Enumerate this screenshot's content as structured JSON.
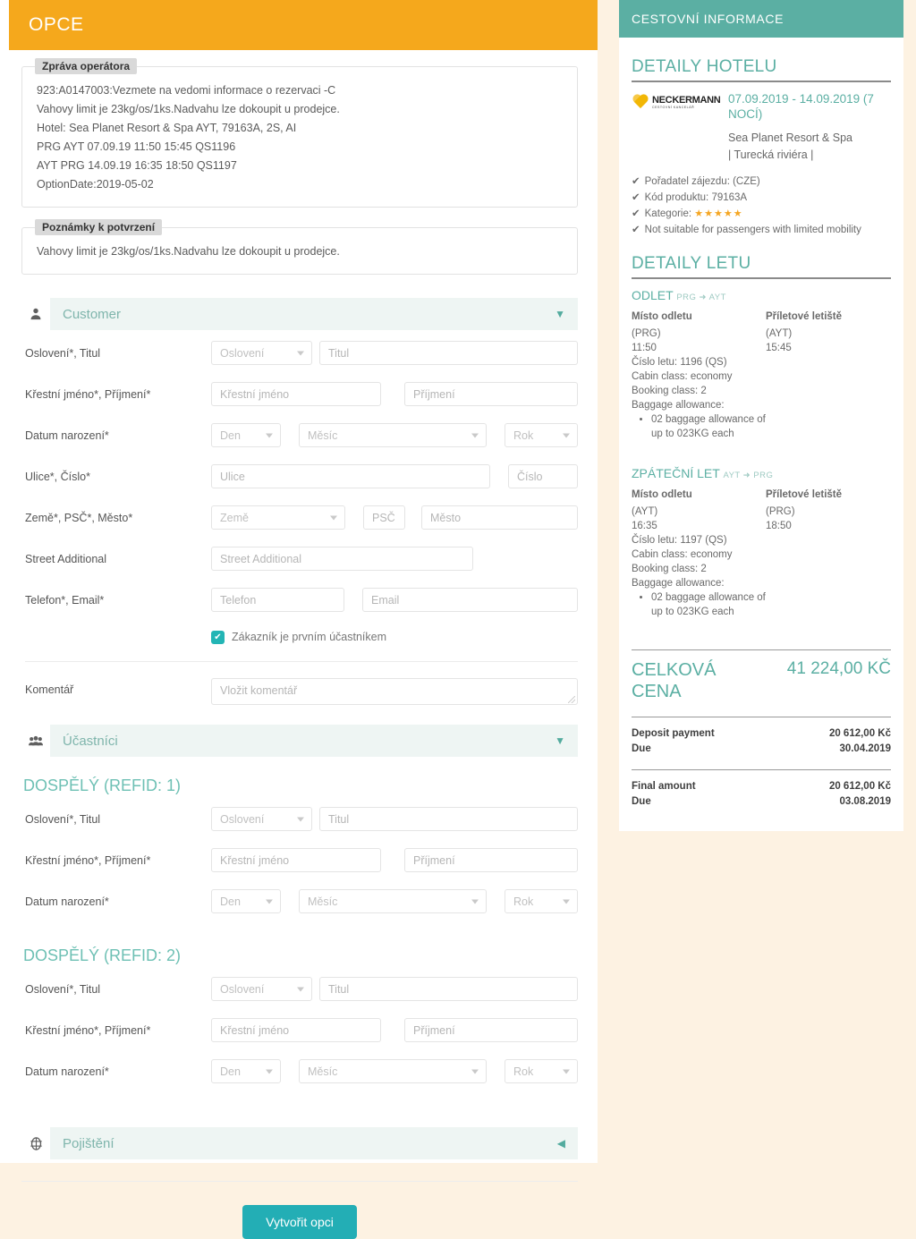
{
  "header": {
    "title": "OPCE"
  },
  "operator_message": {
    "legend": "Zpráva operátora",
    "lines": [
      "923:A0147003:Vezmete na vedomi informace o rezervaci -C",
      "Vahovy limit je 23kg/os/1ks.Nadvahu lze dokoupit u prodejce.",
      "Hotel: Sea Planet Resort & Spa AYT, 79163A, 2S, AI",
      "PRG AYT 07.09.19 11:50 15:45 QS1196",
      "AYT PRG 14.09.19 16:35 18:50 QS1197",
      "OptionDate:2019-05-02"
    ]
  },
  "confirmation_notes": {
    "legend": "Poznámky k potvrzení",
    "lines": [
      "Vahovy limit je 23kg/os/1ks.Nadvahu lze dokoupit u prodejce."
    ]
  },
  "customer_section": {
    "title": "Customer",
    "icon": "user-icon",
    "caret": "▼",
    "rows": {
      "salutation_label": "Oslovení*, Titul",
      "salutation_placeholder": "Oslovení",
      "title_placeholder": "Titul",
      "name_label": "Křestní jméno*, Příjmení*",
      "firstname_placeholder": "Křestní jméno",
      "lastname_placeholder": "Příjmení",
      "dob_label": "Datum narození*",
      "day_placeholder": "Den",
      "month_placeholder": "Měsíc",
      "year_placeholder": "Rok",
      "street_label": "Ulice*, Číslo*",
      "street_placeholder": "Ulice",
      "number_placeholder": "Číslo",
      "country_label": "Země*, PSČ*, Město*",
      "country_placeholder": "Země",
      "zip_placeholder": "PSČ",
      "city_placeholder": "Město",
      "street_add_label": "Street Additional",
      "street_add_placeholder": "Street Additional",
      "contact_label": "Telefon*, Email*",
      "phone_placeholder": "Telefon",
      "email_placeholder": "Email",
      "checkbox_label": "Zákazník je prvním účastníkem",
      "checkbox_checked": true,
      "comment_label": "Komentář",
      "comment_placeholder": "Vložit komentář"
    }
  },
  "participants_section": {
    "title": "Účastníci",
    "icon": "people-icon",
    "caret": "▼",
    "people": [
      {
        "heading": "DOSPĚLÝ (REFID: 1)",
        "salutation_label": "Oslovení*, Titul",
        "salutation_placeholder": "Oslovení",
        "title_placeholder": "Titul",
        "name_label": "Křestní jméno*, Příjmení*",
        "firstname_placeholder": "Křestní jméno",
        "lastname_placeholder": "Příjmení",
        "dob_label": "Datum narození*",
        "day_placeholder": "Den",
        "month_placeholder": "Měsíc",
        "year_placeholder": "Rok"
      },
      {
        "heading": "DOSPĚLÝ (REFID: 2)",
        "salutation_label": "Oslovení*, Titul",
        "salutation_placeholder": "Oslovení",
        "title_placeholder": "Titul",
        "name_label": "Křestní jméno*, Příjmení*",
        "firstname_placeholder": "Křestní jméno",
        "lastname_placeholder": "Příjmení",
        "dob_label": "Datum narození*",
        "day_placeholder": "Den",
        "month_placeholder": "Měsíc",
        "year_placeholder": "Rok"
      }
    ]
  },
  "insurance_section": {
    "title": "Pojištění",
    "icon": "lifebuoy-icon",
    "caret": "◀"
  },
  "submit": {
    "label": "Vytvořit opci"
  },
  "sidebar": {
    "header": "CESTOVNÍ INFORMACE",
    "hotel": {
      "heading": "DETAILY HOTELU",
      "brand": "NECKERMANN",
      "brand_sub": "CESTOVNÍ KANCELÁŘ",
      "dates": "07.09.2019 - 14.09.2019 (7 NOCÍ)",
      "name": "Sea Planet Resort & Spa",
      "region": "| Turecká riviéra |",
      "features": [
        {
          "label": "Pořadatel zájezdu: (CZE)"
        },
        {
          "label": "Kód produktu: 79163A"
        },
        {
          "label": "Kategorie:",
          "stars": "★★★★★"
        },
        {
          "label": "Not suitable for passengers with limited mobility"
        }
      ]
    },
    "flight": {
      "heading": "DETAILY LETU",
      "legs": [
        {
          "title": "ODLET",
          "route": "PRG ➜ AYT",
          "dep_header": "Místo odletu",
          "arr_header": "Příletové letiště",
          "dep_code": "(PRG)",
          "dep_time": "11:50",
          "arr_code": "(AYT)",
          "arr_time": "15:45",
          "flight_no": "Číslo letu: 1196 (QS)",
          "cabin": "Cabin class: economy",
          "booking": "Booking class: 2",
          "baggage_label": "Baggage allowance:",
          "baggage_item": "02 baggage allowance of up to 023KG each"
        },
        {
          "title": "ZPÁTEČNÍ LET",
          "route": "AYT ➜ PRG",
          "dep_header": "Místo odletu",
          "arr_header": "Příletové letiště",
          "dep_code": "(AYT)",
          "dep_time": "16:35",
          "arr_code": "(PRG)",
          "arr_time": "18:50",
          "flight_no": "Číslo letu: 1197 (QS)",
          "cabin": "Cabin class: economy",
          "booking": "Booking class: 2",
          "baggage_label": "Baggage allowance:",
          "baggage_item": "02 baggage allowance of up to 023KG each"
        }
      ]
    },
    "price": {
      "total_label": "CELKOVÁ CENA",
      "total_value": "41 224,00 KČ",
      "deposit_label": "Deposit payment",
      "deposit_value": "20 612,00 Kč",
      "deposit_due_label": "Due",
      "deposit_due_value": "30.04.2019",
      "final_label": "Final amount",
      "final_value": "20 612,00 Kč",
      "final_due_label": "Due",
      "final_due_value": "03.08.2019"
    }
  },
  "colors": {
    "header_orange": "#F5A81C",
    "teal": "#5BAFA3",
    "button_teal": "#23AEB5",
    "page_bg": "#FDF2E2",
    "star_gold": "#F5A623"
  }
}
